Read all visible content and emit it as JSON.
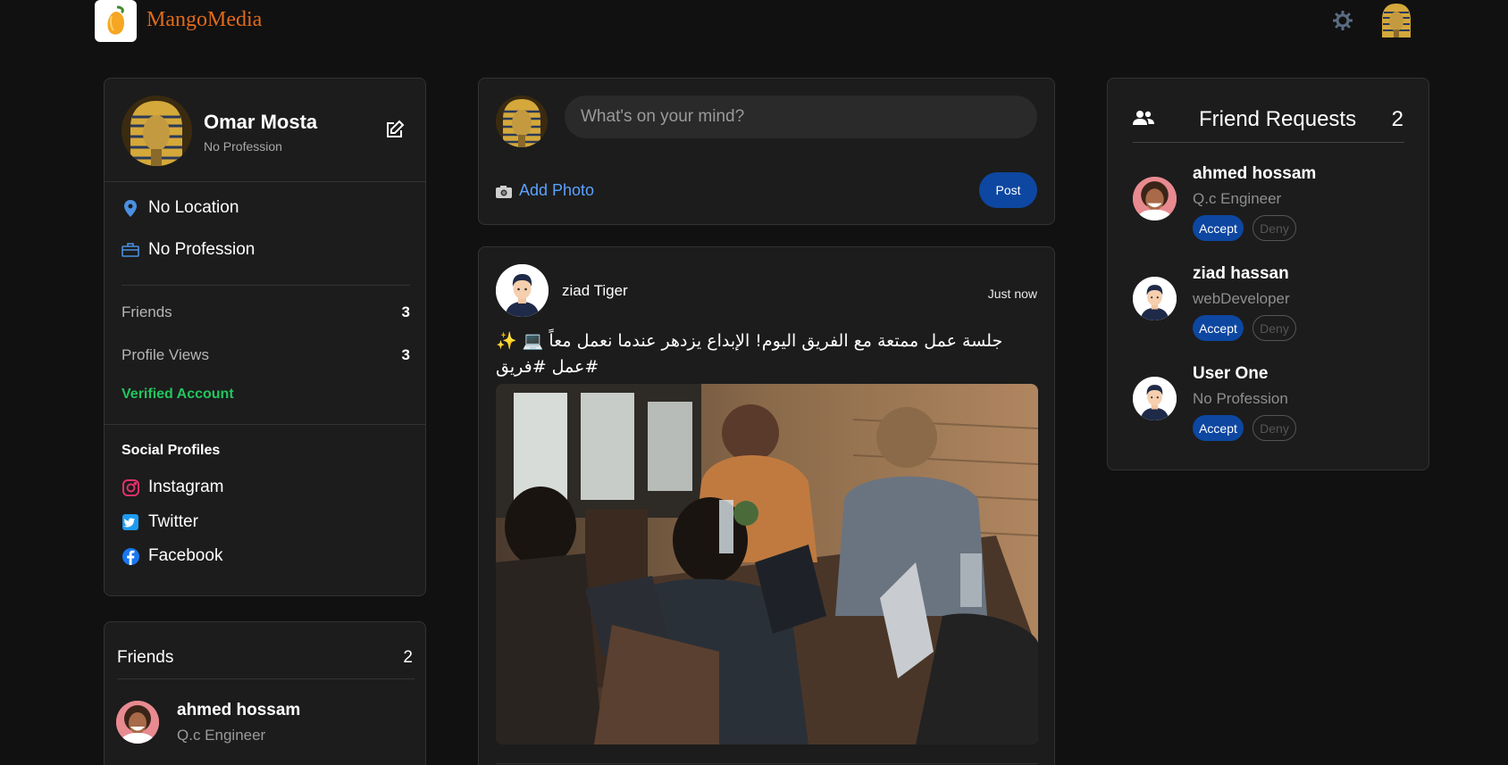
{
  "navbar": {
    "brand": "MangoMedia",
    "accent_color": "#e06a1a",
    "icons": [
      "mango-logo-icon",
      "gear-icon",
      "user-avatar"
    ]
  },
  "profile": {
    "name": "Omar Mosta",
    "subtitle": "No Profession",
    "location": "No Location",
    "profession": "No Profession",
    "stats": [
      {
        "label": "Friends",
        "value": "3"
      },
      {
        "label": "Profile Views",
        "value": "3"
      }
    ],
    "verified": "Verified Account",
    "verified_color": "#22c55e",
    "social_title": "Social Profiles",
    "social": [
      {
        "label": "Instagram",
        "icon": "instagram-icon",
        "color": "#e1306c"
      },
      {
        "label": "Twitter",
        "icon": "twitter-icon",
        "color": "#1d9bf0"
      },
      {
        "label": "Facebook",
        "icon": "facebook-icon",
        "color": "#1877f2"
      }
    ]
  },
  "friends_card": {
    "title": "Friends",
    "count": "2",
    "items": [
      {
        "name": "ahmed hossam",
        "profession": "Q.c Engineer"
      }
    ]
  },
  "composer": {
    "placeholder": "What's on your mind?",
    "add_photo": "Add Photo",
    "post_label": "Post",
    "button_color": "#0d47a1"
  },
  "post": {
    "author": "ziad Tiger",
    "time": "Just now",
    "text": "جلسة عمل ممتعة مع الفريق اليوم! الإبداع يزدهر عندما نعمل معاً 💻 ✨ #عمل #فريق"
  },
  "requests": {
    "title": "Friend Requests",
    "count": "2",
    "accept_label": "Accept",
    "deny_label": "Deny",
    "items": [
      {
        "name": "ahmed hossam",
        "profession": "Q.c Engineer"
      },
      {
        "name": "ziad hassan",
        "profession": "webDeveloper"
      },
      {
        "name": "User One",
        "profession": "No Profession"
      }
    ]
  }
}
